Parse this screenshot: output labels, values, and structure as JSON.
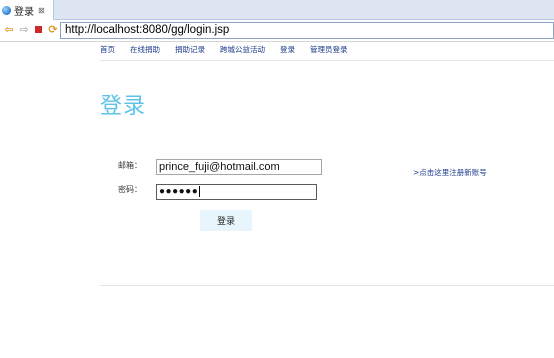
{
  "tab": {
    "title": "登录",
    "close_glyph": "⊠"
  },
  "toolbar": {
    "back_glyph": "⇦",
    "forward_glyph": "⇨",
    "refresh_glyph": "⟳",
    "url": "http://localhost:8080/gg/login.jsp"
  },
  "nav": {
    "items": [
      {
        "label": "首页"
      },
      {
        "label": "在线捐助"
      },
      {
        "label": "捐助记录"
      },
      {
        "label": "跨城公益活动"
      },
      {
        "label": "登录"
      },
      {
        "label": "管理员登录"
      }
    ]
  },
  "page": {
    "title": "登录"
  },
  "form": {
    "email_label": "邮箱：",
    "email_value": "prince_fuji@hotmail.com",
    "password_label": "密码：",
    "password_value": "●●●●●●",
    "register_link": ">点击这里注册新账号",
    "submit_label": "登录"
  },
  "colors": {
    "title": "#5fc2e8",
    "nav_link": "#1a3a8a",
    "button_bg": "#e8f5fd"
  }
}
